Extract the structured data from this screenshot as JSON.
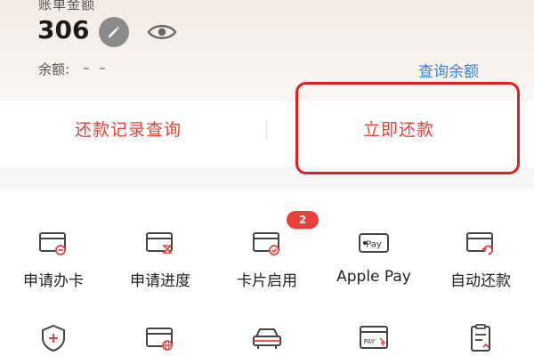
{
  "bill": {
    "label": "账单金额",
    "amount": "306",
    "balance_label": "余额:",
    "balance_value": "– –",
    "check_balance": "查询余额"
  },
  "actions": {
    "records": "还款记录查询",
    "repay_now": "立即还款"
  },
  "services": [
    {
      "label": "申请办卡",
      "icon": "card-apply-icon"
    },
    {
      "label": "申请进度",
      "icon": "card-progress-icon"
    },
    {
      "label": "卡片启用",
      "icon": "card-activate-icon",
      "badge": "2"
    },
    {
      "label": "Apple Pay",
      "icon": "apple-pay-icon"
    },
    {
      "label": "自动还款",
      "icon": "auto-repay-icon"
    }
  ],
  "services_row2": [
    {
      "icon": "shield-plus-icon"
    },
    {
      "icon": "card-globe-icon"
    },
    {
      "icon": "car-icon"
    },
    {
      "icon": "pay-card-icon"
    },
    {
      "icon": "clipboard-icon"
    }
  ],
  "colors": {
    "accent_red": "#e8413b",
    "link_blue": "#3b7fd8",
    "highlight_border": "#e0201e"
  }
}
